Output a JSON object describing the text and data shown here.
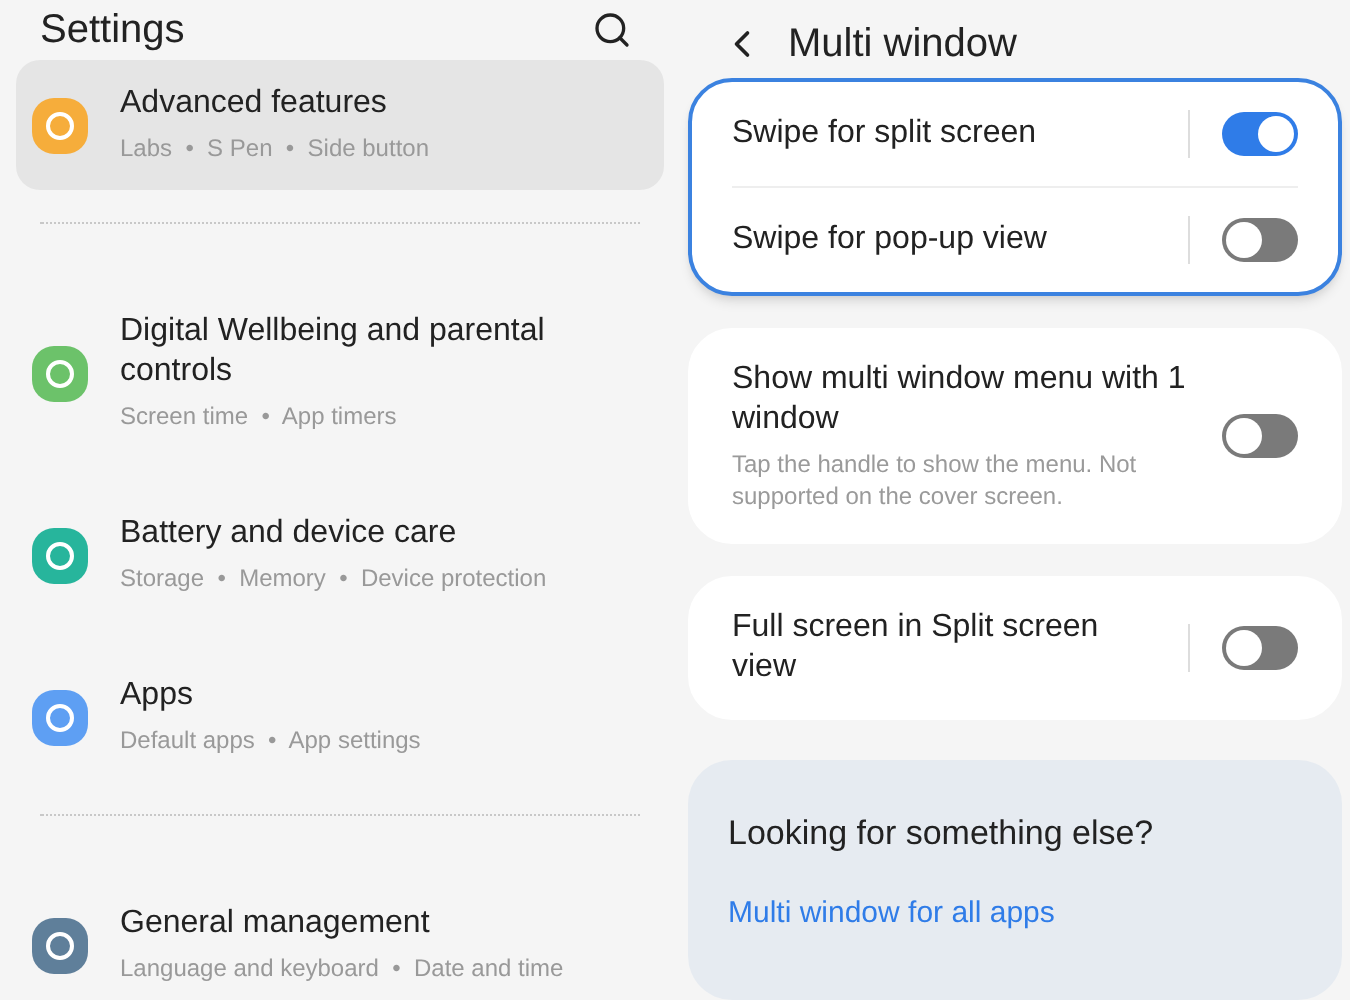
{
  "settings": {
    "title": "Settings",
    "groups": [
      {
        "items": [
          {
            "title": "Advanced features",
            "subtitle": "Labs  •  S Pen  •  Side button",
            "color": "#f6ad3b",
            "selected": true
          }
        ]
      },
      {
        "items": [
          {
            "title": "Digital Wellbeing and parental controls",
            "subtitle": "Screen time  •  App timers",
            "color": "#6cc26a",
            "selected": false
          },
          {
            "title": "Battery and device care",
            "subtitle": "Storage  •  Memory  •  Device protection",
            "color": "#27b59c",
            "selected": false
          },
          {
            "title": "Apps",
            "subtitle": "Default apps  •  App settings",
            "color": "#5e9ff3",
            "selected": false
          }
        ]
      },
      {
        "items": [
          {
            "title": "General management",
            "subtitle": "Language and keyboard  •  Date and time",
            "color": "#5f7f9a",
            "selected": false
          }
        ]
      }
    ]
  },
  "detail": {
    "title": "Multi window",
    "cards": [
      {
        "highlighted": true,
        "rows": [
          {
            "title": "Swipe for split screen",
            "on": true
          },
          {
            "title": "Swipe for pop-up view",
            "on": false
          }
        ]
      },
      {
        "highlighted": false,
        "rows": [
          {
            "title": "Show multi window menu with 1 window",
            "description": "Tap the handle to show the menu. Not supported on the cover screen.",
            "on": false
          }
        ]
      },
      {
        "highlighted": false,
        "rows": [
          {
            "title": "Full screen in Split screen view",
            "on": false
          }
        ]
      }
    ],
    "suggest": {
      "heading": "Looking for something else?",
      "link": "Multi window for all apps"
    }
  }
}
